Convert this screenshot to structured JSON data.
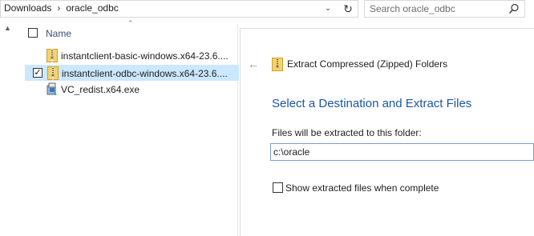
{
  "address_bar": {
    "breadcrumbs": [
      "Downloads",
      "oracle_odbc"
    ]
  },
  "search": {
    "placeholder": "Search oracle_odbc"
  },
  "file_list": {
    "column_name": "Name",
    "files": [
      {
        "name": "instantclient-basic-windows.x64-23.6....",
        "icon": "zip-folder-icon",
        "selected": false,
        "checked": false
      },
      {
        "name": "instantclient-odbc-windows.x64-23.6....",
        "icon": "zip-folder-icon",
        "selected": true,
        "checked": true
      },
      {
        "name": "VC_redist.x64.exe",
        "icon": "installer-icon",
        "selected": false,
        "checked": false
      }
    ]
  },
  "extract_dialog": {
    "window_title": "Extract Compressed (Zipped) Folders",
    "heading": "Select a Destination and Extract Files",
    "destination_label": "Files will be extracted to this folder:",
    "destination_value": "c:\\oracle",
    "show_files_label": "Show extracted files when complete",
    "show_files_checked": false
  },
  "colors": {
    "heading": "#1e56a0",
    "selection": "#cce8ff",
    "column_header": "#3b4f75"
  }
}
